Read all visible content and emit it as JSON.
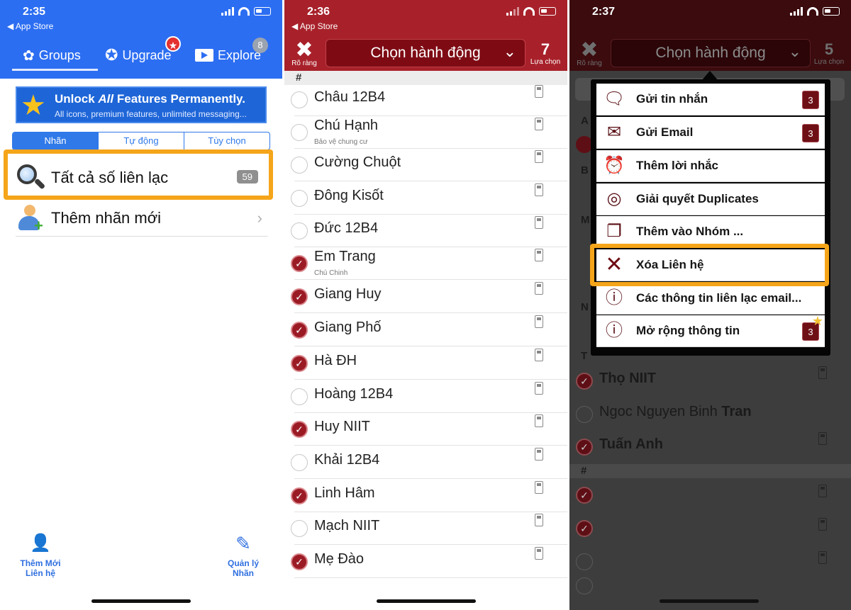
{
  "panel1": {
    "time": "2:35",
    "back_label": "◀ App Store",
    "tabs": [
      {
        "label": "Groups",
        "icon": "groups-icon"
      },
      {
        "label": "Upgrade",
        "icon": "star-icon",
        "badge": "★"
      },
      {
        "label": "Explore",
        "icon": "play-icon",
        "badge": "8"
      }
    ],
    "banner": {
      "title_pre": "Unlock ",
      "title_em": "All",
      "title_post": " Features Permanently.",
      "subtitle": "All icons, premium features, unlimited messaging..."
    },
    "segments": [
      "Nhãn",
      "Tự động",
      "Tùy chọn"
    ],
    "rows": [
      {
        "label": "Tất cả số liên lạc",
        "count": "59"
      },
      {
        "label": "Thêm nhãn mới"
      }
    ],
    "bottom_left": {
      "line1": "Thêm Mới",
      "line2": "Liên hệ"
    },
    "bottom_right": {
      "line1": "Quản lý",
      "line2": "Nhãn"
    }
  },
  "panel2": {
    "time": "2:36",
    "back_label": "◀ App Store",
    "clear_label": "Rõ ràng",
    "action_label": "Chọn hành động",
    "selected_count": "7",
    "selected_label": "Lựa chọn",
    "section": "#",
    "contacts": [
      {
        "name": "Châu 12B4",
        "checked": false
      },
      {
        "name": "Chú Hạnh",
        "sub": "Bảo vệ chung cư",
        "checked": false
      },
      {
        "name": "Cường Chuột",
        "checked": false
      },
      {
        "name": "Đông Kisốt",
        "checked": false
      },
      {
        "name": "Đức 12B4",
        "checked": false
      },
      {
        "name": "Em Trang",
        "sub": "Chú Chinh",
        "checked": true
      },
      {
        "name": "Giang Huy",
        "checked": true
      },
      {
        "name": "Giang Phố",
        "checked": true
      },
      {
        "name": "Hà ĐH",
        "checked": true
      },
      {
        "name": "Hoàng 12B4",
        "checked": false
      },
      {
        "name": "Huy NIIT",
        "checked": true
      },
      {
        "name": "Khải 12B4",
        "checked": false
      },
      {
        "name": "Linh Hâm",
        "checked": true
      },
      {
        "name": "Mạch NIIT",
        "checked": false
      },
      {
        "name": "Mẹ Đào",
        "checked": true
      }
    ]
  },
  "panel3": {
    "time": "2:37",
    "clear_label": "Rõ ràng",
    "action_label": "Chọn hành động",
    "selected_count": "5",
    "selected_label": "Lựa chọn",
    "menu": [
      {
        "label": "Gửi tin nhắn",
        "icon": "message-icon",
        "badge": "3"
      },
      {
        "label": "Gửi Email",
        "icon": "envelope-icon",
        "badge": "3"
      },
      {
        "label": "Thêm lời nhắc",
        "icon": "alarm-clock-icon"
      },
      {
        "label": "Giải quyết Duplicates",
        "icon": "duplicates-icon"
      },
      {
        "label": "Thêm vào Nhóm ...",
        "icon": "documents-icon"
      },
      {
        "label": "Xóa Liên hệ",
        "icon": "delete-x-icon"
      },
      {
        "label": "Các thông tin liên lạc email...",
        "icon": "info-icon"
      },
      {
        "label": "Mở rộng thông tin",
        "icon": "info-plus-icon",
        "badge": "3"
      }
    ],
    "side_letters": [
      "A",
      "B",
      "M",
      "N",
      "T"
    ],
    "section": "#",
    "contacts_below": [
      {
        "name": "Thọ NIIT",
        "checked": true
      },
      {
        "name_pre": "Ngoc Nguyen Binh ",
        "name_bold": "Tran",
        "checked": false
      },
      {
        "name": "Tuấn Anh",
        "checked": true
      }
    ]
  }
}
